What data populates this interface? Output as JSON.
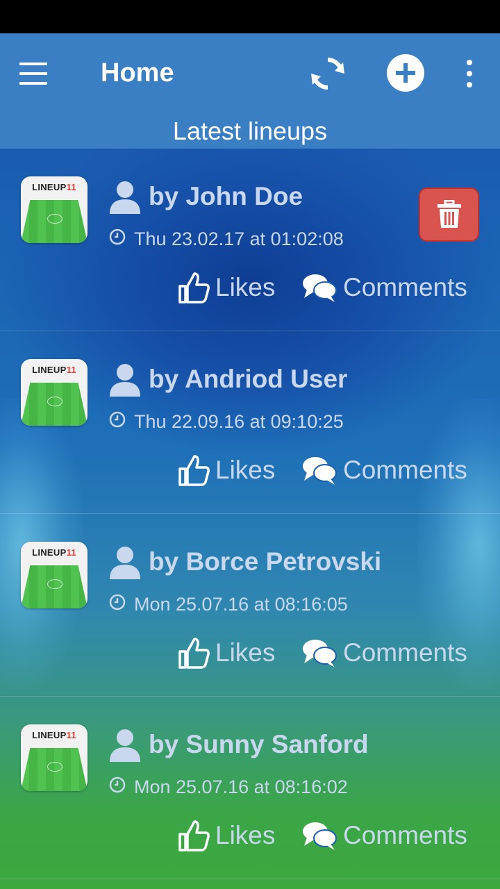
{
  "app_bar": {
    "title": "Home",
    "subtitle": "Latest lineups",
    "icons": [
      "menu-icon",
      "refresh-icon",
      "add-icon",
      "overflow-icon"
    ]
  },
  "lineups": [
    {
      "thumb_logo": "LINEUP",
      "thumb_logo_num": "11",
      "author": "by John Doe",
      "date": "Thu 23.02.17 at 01:02:08",
      "likes_label": "Likes",
      "comments_label": "Comments",
      "deletable": true
    },
    {
      "thumb_logo": "LINEUP",
      "thumb_logo_num": "11",
      "author": "by Andriod User",
      "date": "Thu 22.09.16 at 09:10:25",
      "likes_label": "Likes",
      "comments_label": "Comments",
      "deletable": false
    },
    {
      "thumb_logo": "LINEUP",
      "thumb_logo_num": "11",
      "author": "by Borce Petrovski",
      "date": "Mon 25.07.16 at 08:16:05",
      "likes_label": "Likes",
      "comments_label": "Comments",
      "deletable": false
    },
    {
      "thumb_logo": "LINEUP",
      "thumb_logo_num": "11",
      "author": "by Sunny Sanford",
      "date": "Mon 25.07.16 at 08:16:02",
      "likes_label": "Likes",
      "comments_label": "Comments",
      "deletable": false
    }
  ],
  "colors": {
    "app_bar": "#3a7ec3",
    "text_muted": "#c9d8ee",
    "delete": "#d9534f"
  }
}
